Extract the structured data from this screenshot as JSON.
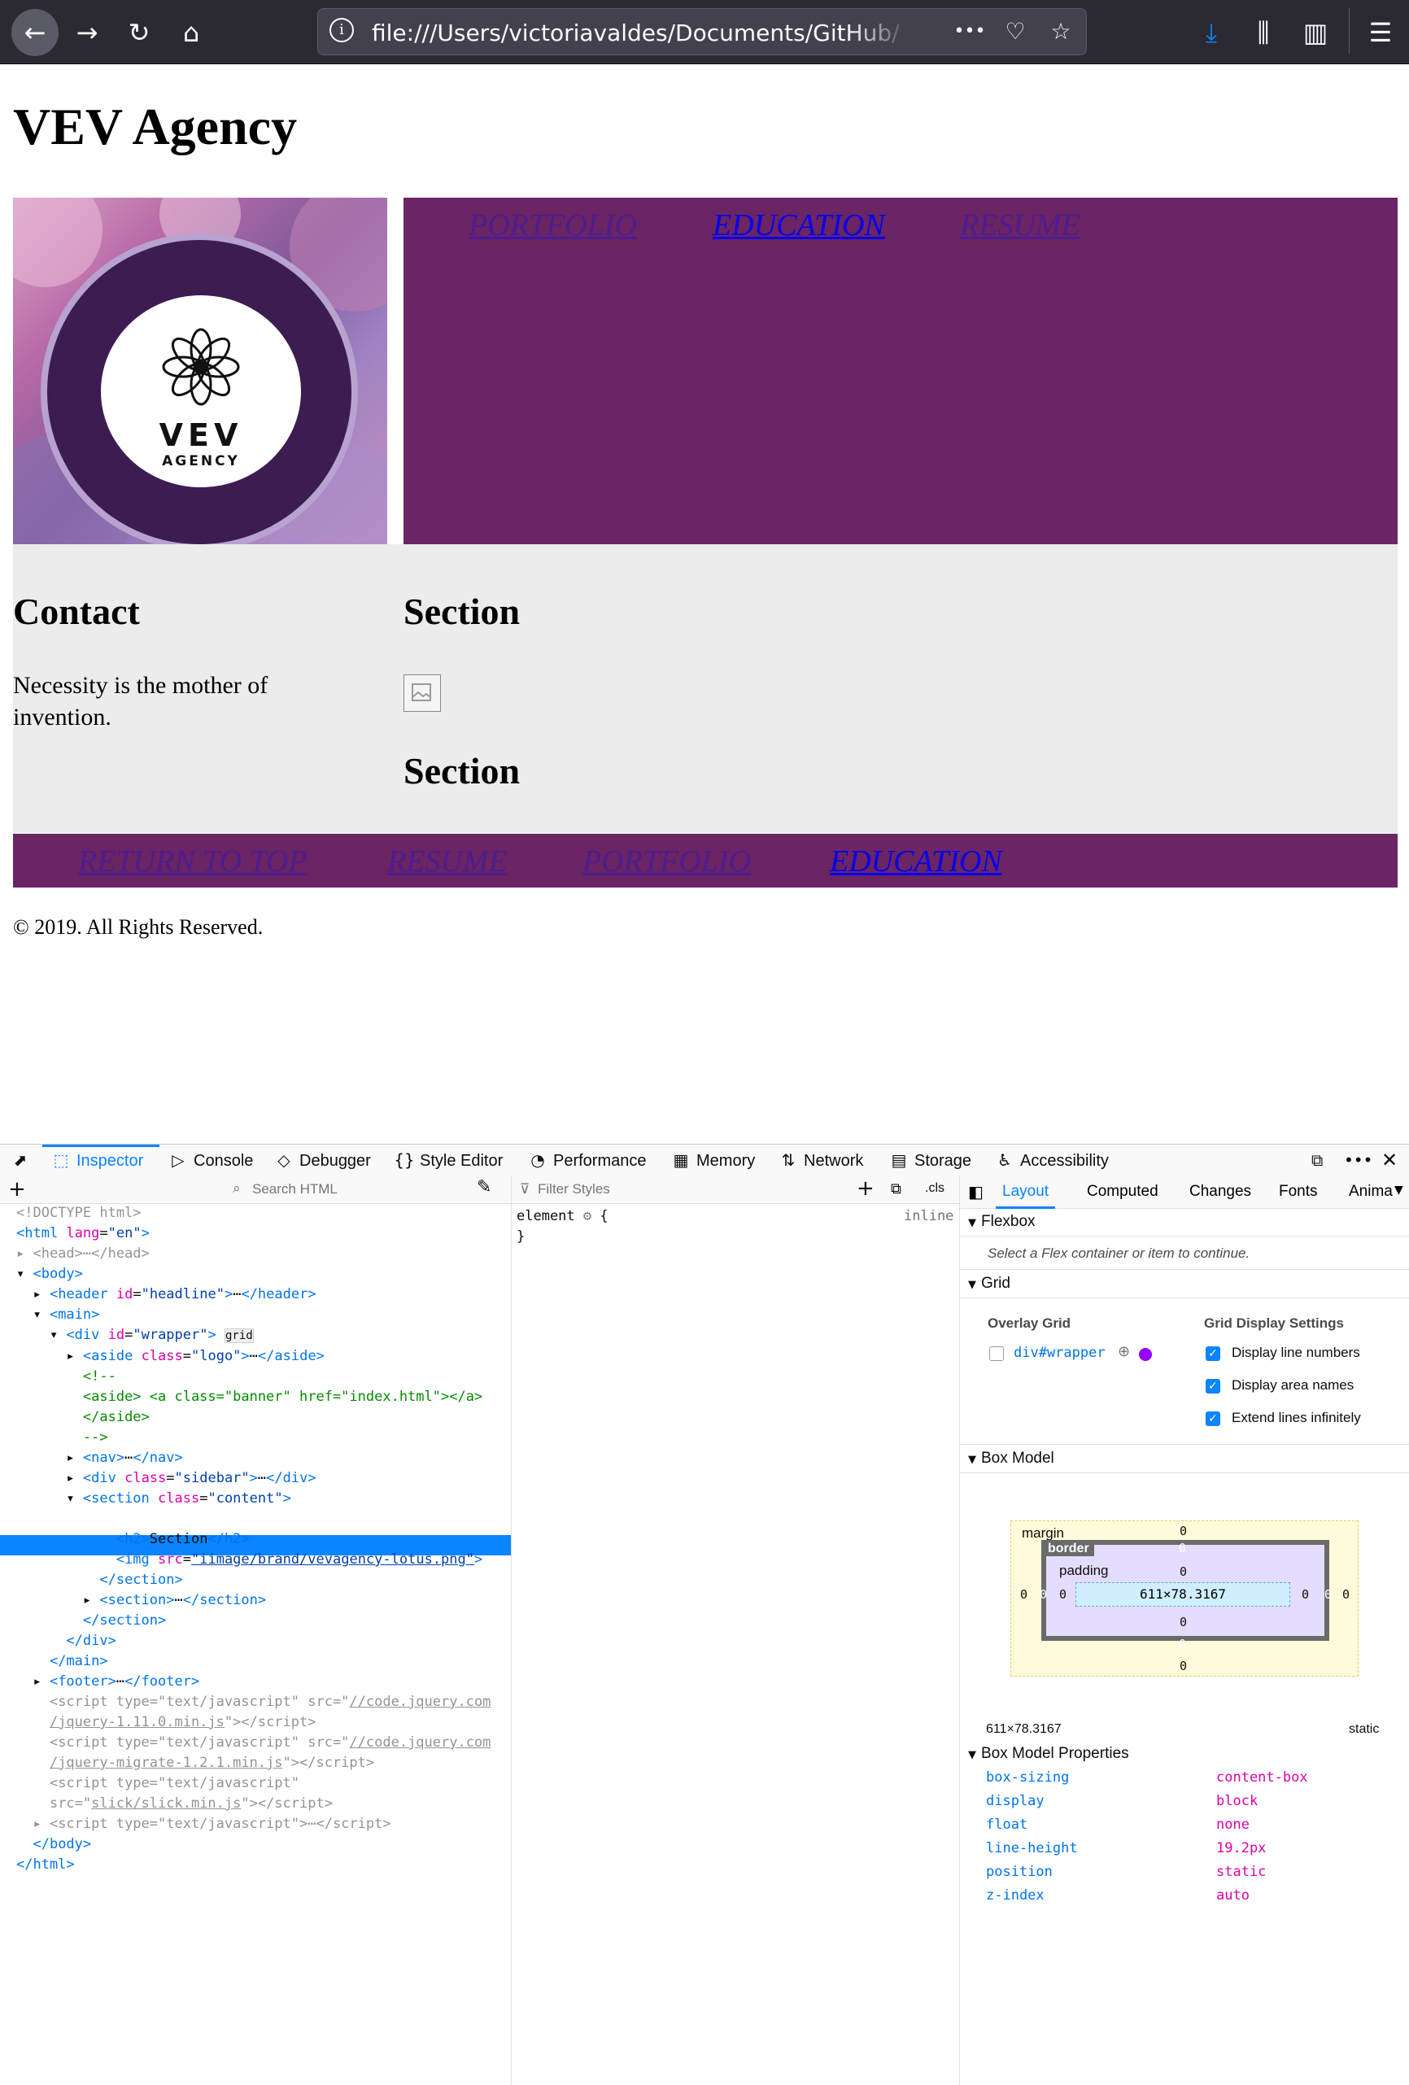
{
  "browser": {
    "url": "file:///Users/victoriavaldes/Documents/GitHub/veva",
    "back_icon": "←",
    "forward_icon": "→",
    "reload_icon": "↻",
    "home_icon": "⌂",
    "page_actions_icon": "•••",
    "pocket_icon": "♡",
    "bookmark_icon": "☆",
    "download_icon": "⤓",
    "library_icon": "⫼",
    "sidebar_icon": "▥",
    "menu_icon": "☰"
  },
  "page": {
    "headline": "VEV Agency",
    "logo_text": "VEV",
    "logo_subtext": "AGENCY",
    "top_nav": [
      "PORTFOLIO",
      "EDUCATION",
      "RESUME"
    ],
    "contact_heading": "Contact",
    "contact_text": "Necessity is the mother of invention.",
    "section1_heading": "Section",
    "section2_heading": "Section",
    "footer_nav": [
      "RETURN TO TOP",
      "RESUME",
      "PORTFOLIO",
      "EDUCATION"
    ],
    "copyright": "© 2019. All Rights Reserved."
  },
  "colors": {
    "brand_purple": "#6b2464",
    "content_gray": "#ececec",
    "devtools_accent": "#0a84ff"
  },
  "devtools": {
    "tabs": [
      {
        "label": "Inspector",
        "icon": "⬚"
      },
      {
        "label": "Console",
        "icon": "▷"
      },
      {
        "label": "Debugger",
        "icon": "◇"
      },
      {
        "label": "Style Editor",
        "icon": "{}"
      },
      {
        "label": "Performance",
        "icon": "◔"
      },
      {
        "label": "Memory",
        "icon": "▦"
      },
      {
        "label": "Network",
        "icon": "⇅"
      },
      {
        "label": "Storage",
        "icon": "▤"
      },
      {
        "label": "Accessibility",
        "icon": "♿"
      }
    ],
    "search_html_placeholder": "Search HTML",
    "filter_styles_placeholder": "Filter Styles",
    "cls_label": ".cls",
    "element_rule": "element",
    "element_rule_open": "{",
    "element_rule_close": "}",
    "element_display": "inline",
    "layout_tabs": [
      "Layout",
      "Computed",
      "Changes",
      "Fonts",
      "Anima"
    ],
    "flexbox_heading": "Flexbox",
    "flexbox_hint": "Select a Flex container or item to continue.",
    "grid_heading": "Grid",
    "overlay_grid_label": "Overlay Grid",
    "grid_item": "div#wrapper",
    "grid_display_settings": "Grid Display Settings",
    "grid_options": [
      "Display line numbers",
      "Display area names",
      "Extend lines infinitely"
    ],
    "box_model_heading": "Box Model",
    "box_model": {
      "margin_label": "margin",
      "border_label": "border",
      "padding_label": "padding",
      "content_size": "611×78.3167",
      "margin_top": "0",
      "margin_right": "0",
      "margin_bottom": "0",
      "margin_left": "0",
      "border_top": "0",
      "border_right": "0",
      "border_bottom": "0",
      "border_left": "0",
      "padding_top": "0",
      "padding_right": "0",
      "padding_bottom": "0",
      "padding_left": "0"
    },
    "element_size": "611×78.3167",
    "element_position": "static",
    "box_model_props_heading": "Box Model Properties",
    "box_model_props": [
      {
        "name": "box-sizing",
        "value": "content-box"
      },
      {
        "name": "display",
        "value": "block"
      },
      {
        "name": "float",
        "value": "none"
      },
      {
        "name": "line-height",
        "value": "19.2px"
      },
      {
        "name": "position",
        "value": "static"
      },
      {
        "name": "z-index",
        "value": "auto"
      }
    ]
  }
}
